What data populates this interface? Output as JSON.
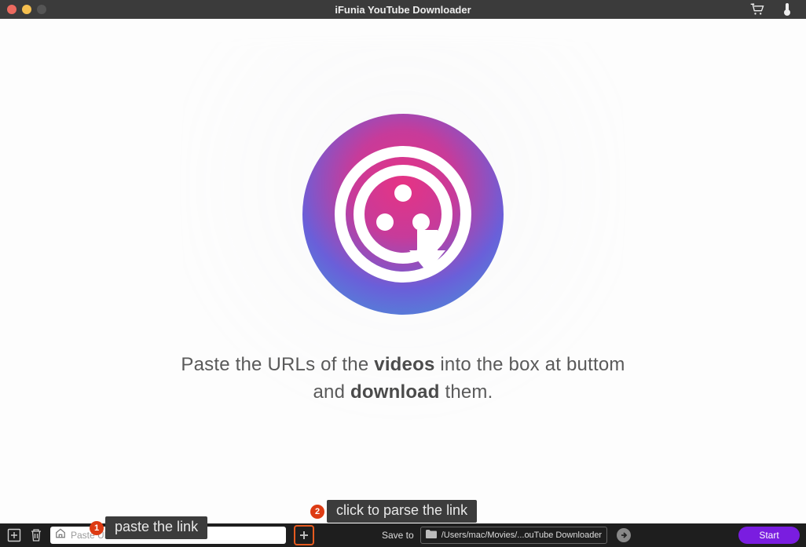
{
  "titlebar": {
    "title": "iFunia YouTube Downloader"
  },
  "instruction": {
    "line1_pre": "Paste the URLs of the ",
    "line1_bold": "videos",
    "line1_post": " into the box at buttom",
    "line2_pre": "and ",
    "line2_bold": "download",
    "line2_post": " them."
  },
  "bottombar": {
    "url_placeholder": "Paste URL here",
    "save_label": "Save to",
    "path_text": "/Users/mac/Movies/...ouTube Downloader",
    "start_label": "Start"
  },
  "tutorial": {
    "step1_num": "1",
    "step1_text": "paste the link",
    "step2_num": "2",
    "step2_text": "click to parse the link"
  },
  "icons": {
    "cart": "cart-icon",
    "thermo": "thermometer-icon",
    "add_box": "add-box-icon",
    "trash": "trash-icon",
    "home": "home-icon",
    "plus": "plus-icon",
    "folder": "folder-icon",
    "arrow": "arrow-right-icon"
  }
}
